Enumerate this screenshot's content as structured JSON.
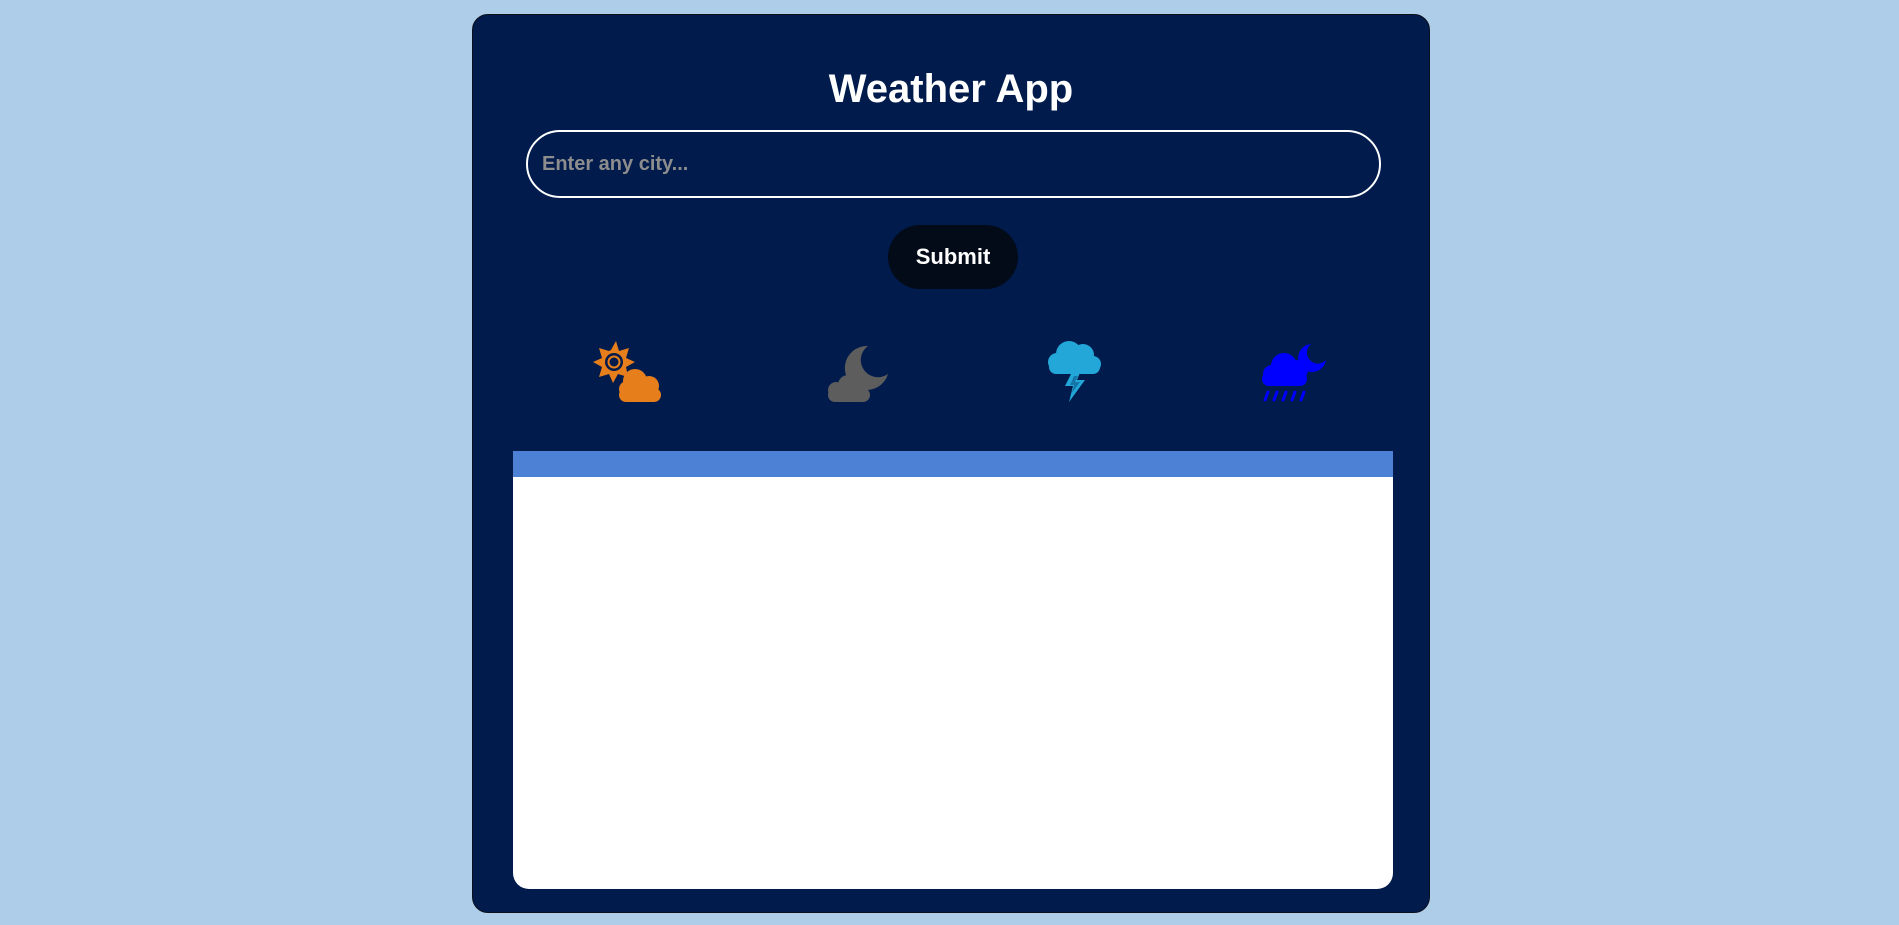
{
  "app": {
    "title": "Weather App"
  },
  "search": {
    "placeholder": "Enter any city...",
    "value": ""
  },
  "submit": {
    "label": "Submit"
  },
  "icons": [
    {
      "name": "sun-behind-cloud-icon",
      "color": "#e67e1b"
    },
    {
      "name": "moon-behind-cloud-icon",
      "color": "#5d5d5d"
    },
    {
      "name": "thunderstorm-cloud-icon",
      "color": "#23a6d8"
    },
    {
      "name": "night-rain-cloud-icon",
      "color": "#0000ff"
    }
  ],
  "colors": {
    "page_background": "#aecde9",
    "card_background": "#001b4c",
    "button_background": "#030b18",
    "result_header": "#4c81d6"
  }
}
